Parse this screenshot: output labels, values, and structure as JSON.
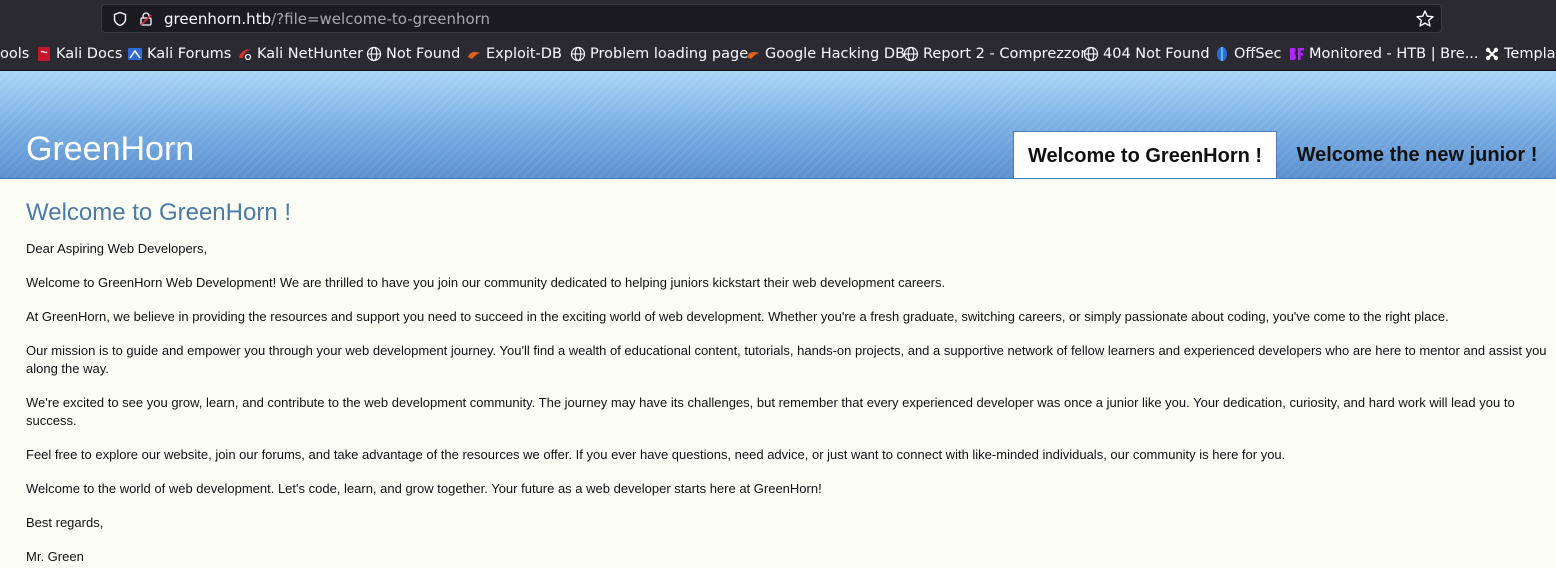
{
  "browser": {
    "url_host": "greenhorn.htb",
    "url_path": "/?file=welcome-to-greenhorn",
    "bookmarks": [
      {
        "label": "ools",
        "icon": "none"
      },
      {
        "label": "Kali Docs",
        "icon": "kali-docs-icon"
      },
      {
        "label": "Kali Forums",
        "icon": "kali-forums-icon"
      },
      {
        "label": "Kali NetHunter",
        "icon": "kali-nethunter-icon"
      },
      {
        "label": "Not Found",
        "icon": "globe-icon"
      },
      {
        "label": "Exploit-DB",
        "icon": "exploit-db-icon"
      },
      {
        "label": "Problem loading page",
        "icon": "globe-icon"
      },
      {
        "label": "Google Hacking DB",
        "icon": "ghdb-icon"
      },
      {
        "label": "Report 2 - Comprezzor",
        "icon": "globe-icon"
      },
      {
        "label": "404 Not Found",
        "icon": "globe-icon"
      },
      {
        "label": "OffSec",
        "icon": "offsec-icon"
      },
      {
        "label": "Monitored - HTB | Bre...",
        "icon": "bf-icon"
      },
      {
        "label": "Templat",
        "icon": "joomla-icon"
      }
    ]
  },
  "site": {
    "title": "GreenHorn",
    "tabs": [
      "Welcome to GreenHorn !",
      "Welcome the new junior !"
    ]
  },
  "article": {
    "heading": "Welcome to GreenHorn !",
    "paragraphs": [
      "Dear Aspiring Web Developers,",
      "Welcome to GreenHorn Web Development! We are thrilled to have you join our community dedicated to helping juniors kickstart their web development careers.",
      "At GreenHorn, we believe in providing the resources and support you need to succeed in the exciting world of web development. Whether you're a fresh graduate, switching careers, or simply passionate about coding, you've come to the right place.",
      "Our mission is to guide and empower you through your web development journey. You'll find a wealth of educational content, tutorials, hands-on projects, and a supportive network of fellow learners and experienced developers who are here to mentor and assist you along the way.",
      "We're excited to see you grow, learn, and contribute to the web development community. The journey may have its challenges, but remember that every experienced developer was once a junior like you. Your dedication, curiosity, and hard work will lead you to success.",
      "Feel free to explore our website, join our forums, and take advantage of the resources we offer. If you ever have questions, need advice, or just want to connect with like-minded individuals, our community is here for you.",
      "Welcome to the world of web development. Let's code, learn, and grow together. Your future as a web developer starts here at GreenHorn!",
      "Best regards,",
      "Mr. Green"
    ]
  }
}
